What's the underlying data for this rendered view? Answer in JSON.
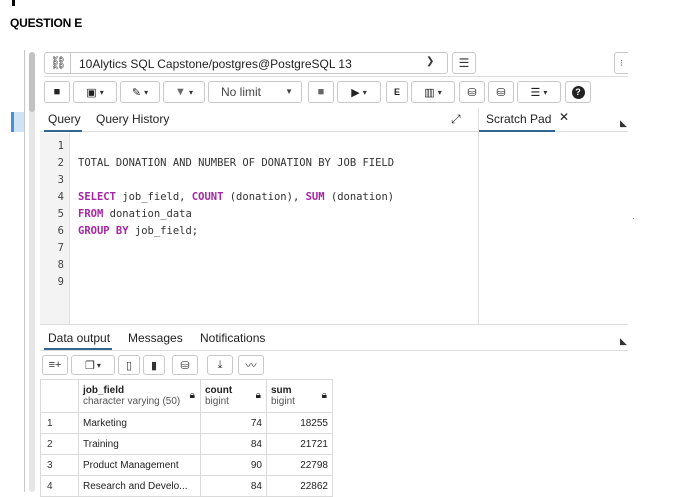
{
  "heading": "QUESTION E",
  "connection": {
    "label": "10Alytics SQL Capstone/postgres@PostgreSQL 13"
  },
  "toolbar": {
    "limit_value": "No limit"
  },
  "editor_tabs": {
    "query": "Query",
    "history": "Query History",
    "scratch": "Scratch Pad"
  },
  "editor": {
    "line_numbers": [
      "1",
      "2",
      "3",
      "4",
      "5",
      "6",
      "7",
      "8",
      "9"
    ],
    "lines": {
      "l2": "TOTAL DONATION AND NUMBER OF DONATION BY JOB FIELD",
      "l4_kw1": "SELECT",
      "l4_a": " job_field, ",
      "l4_fn1": "COUNT",
      "l4_b": " (donation), ",
      "l4_fn2": "SUM",
      "l4_c": " (donation)",
      "l5_kw": "FROM",
      "l5_a": " donation_data",
      "l6_kw": "GROUP BY",
      "l6_a": " job_field;"
    }
  },
  "output_tabs": {
    "data": "Data output",
    "messages": "Messages",
    "notifications": "Notifications"
  },
  "grid": {
    "columns": [
      {
        "name": "job_field",
        "type": "character varying (50)"
      },
      {
        "name": "count",
        "type": "bigint"
      },
      {
        "name": "sum",
        "type": "bigint"
      }
    ],
    "rows": [
      {
        "n": "1",
        "job_field": "Marketing",
        "count": "74",
        "sum": "18255"
      },
      {
        "n": "2",
        "job_field": "Training",
        "count": "84",
        "sum": "21721"
      },
      {
        "n": "3",
        "job_field": "Product Management",
        "count": "90",
        "sum": "22798"
      },
      {
        "n": "4",
        "job_field": "Research and Develo...",
        "count": "84",
        "sum": "22862"
      }
    ]
  }
}
